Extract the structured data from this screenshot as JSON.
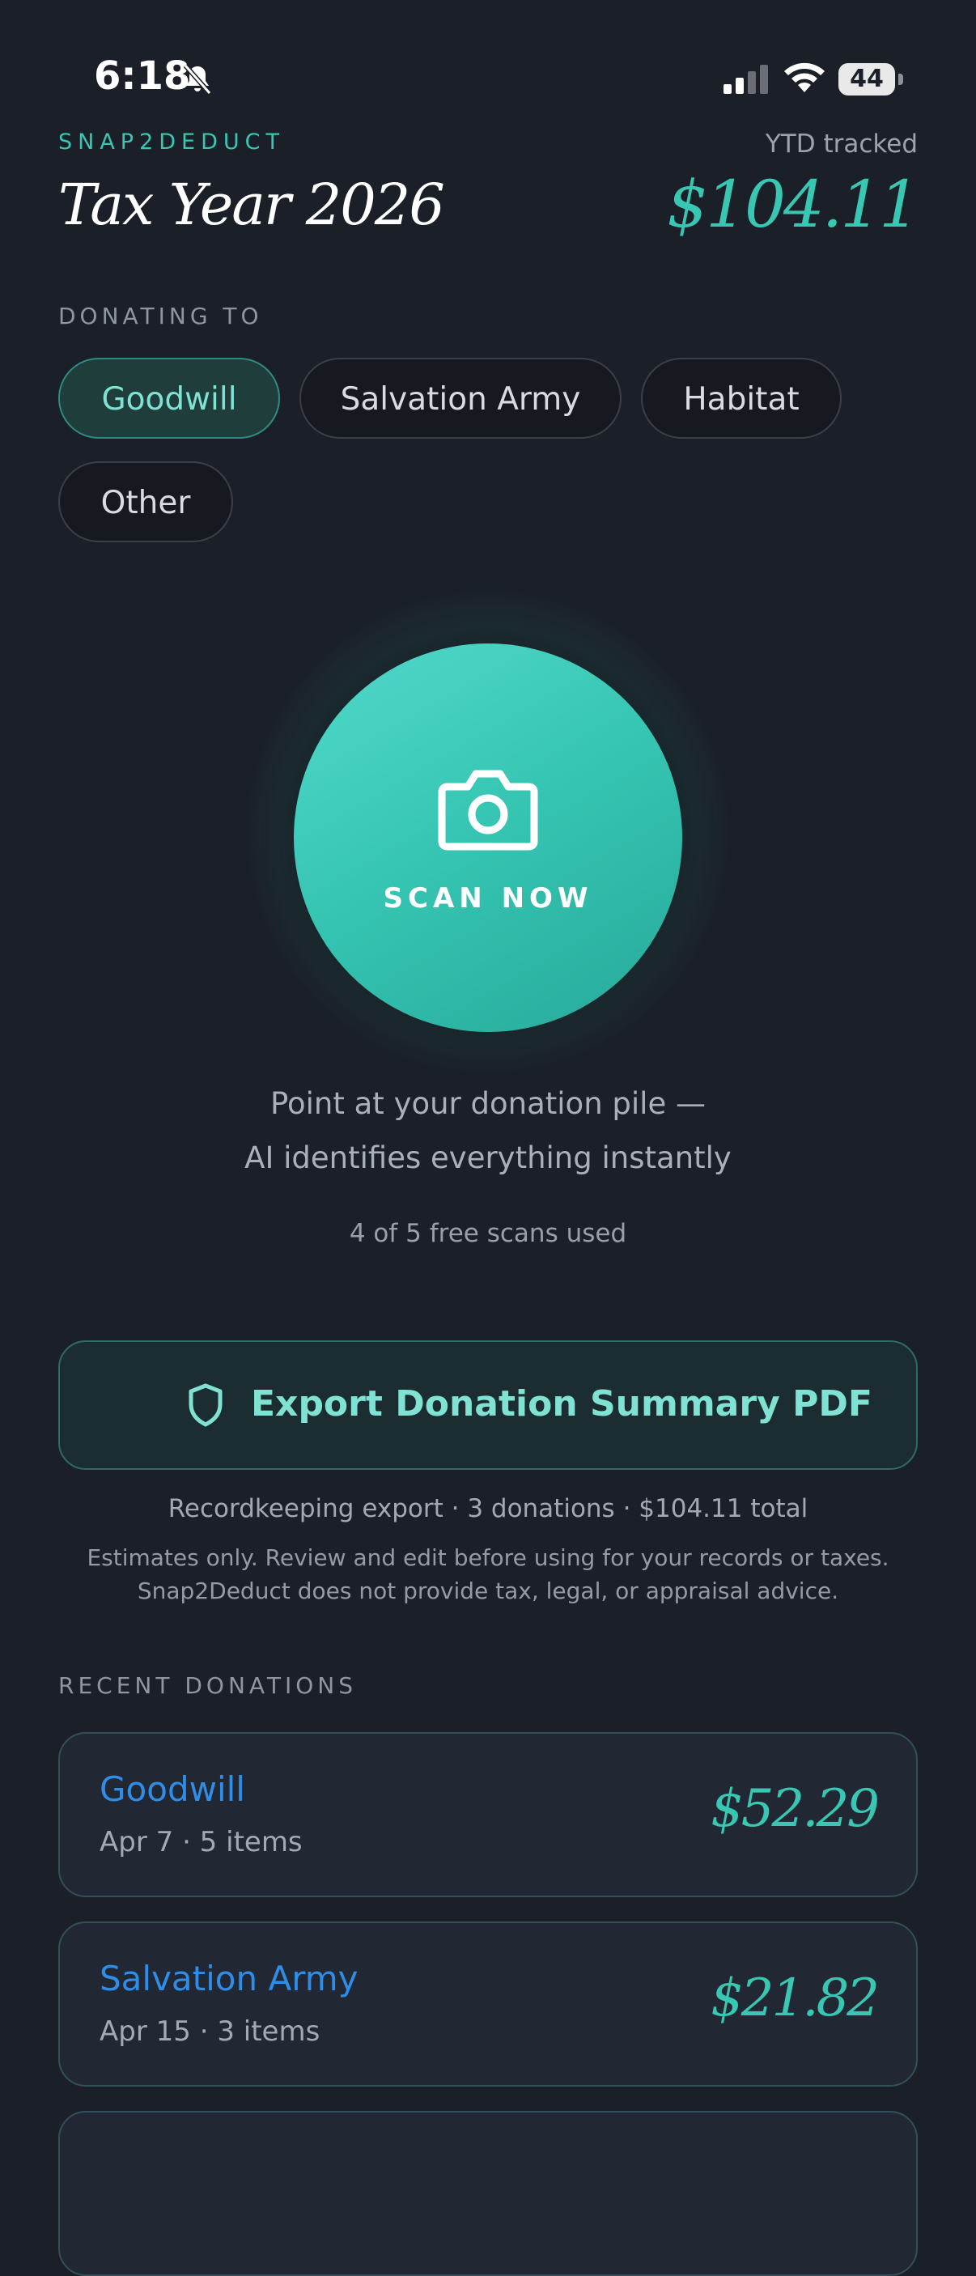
{
  "status_bar": {
    "time": "6:18",
    "battery": "44"
  },
  "header": {
    "brand": "SNAP2DEDUCT",
    "title": "Tax Year 2026",
    "ytd_label": "YTD tracked",
    "ytd_value": "$104.11"
  },
  "donating_to": {
    "label": "DONATING TO",
    "options": [
      "Goodwill",
      "Salvation Army",
      "Habitat",
      "Other"
    ],
    "selected": "Goodwill"
  },
  "scan": {
    "label": "SCAN NOW",
    "hint_line1": "Point at your donation pile —",
    "hint_line2": "AI identifies everything instantly",
    "usage": "4 of 5 free scans used"
  },
  "export": {
    "label": "Export Donation Summary PDF",
    "meta": "Recordkeeping export · 3 donations · $104.11 total",
    "disclaimer_line1": "Estimates only. Review and edit before using for your records or taxes.",
    "disclaimer_line2": "Snap2Deduct does not provide tax, legal, or appraisal advice."
  },
  "recent": {
    "label": "RECENT DONATIONS",
    "items": [
      {
        "org": "Goodwill",
        "meta": "Apr 7 · 5 items",
        "amount": "$52.29"
      },
      {
        "org": "Salvation Army",
        "meta": "Apr 15 · 3 items",
        "amount": "$21.82"
      }
    ]
  },
  "colors": {
    "background": "#1b1f27",
    "accent": "#37c7b3",
    "link": "#2f8de8"
  }
}
